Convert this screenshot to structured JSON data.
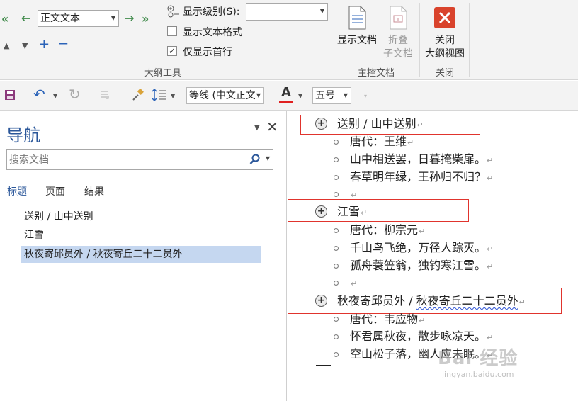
{
  "ribbon": {
    "outline_level": {
      "value": "正文文本"
    },
    "show_level": {
      "label": "显示级别(S):",
      "value": ""
    },
    "show_text_formatting": {
      "label": "显示文本格式",
      "checked": false
    },
    "show_first_line_only": {
      "label": "仅显示首行",
      "checked": true
    },
    "outline_tools_group": "大纲工具",
    "show_document": "显示文档",
    "collapse_subdocs": [
      "折叠",
      "子文档"
    ],
    "master_document_group": "主控文档",
    "close_outline_view": [
      "关闭",
      "大纲视图"
    ],
    "close_group": "关闭",
    "icons": {
      "promote_to_heading1": "double-left-arrow-icon",
      "promote": "left-arrow-icon",
      "demote": "right-arrow-icon",
      "demote_to_body": "double-right-arrow-icon",
      "move_up": "triangle-up-icon",
      "move_down": "triangle-down-icon",
      "expand": "plus-icon",
      "collapse": "minus-icon",
      "show_document": "document-icon",
      "collapse_subdocs": "document-icon",
      "close_outline_view": "close-icon"
    },
    "accent_green": "#3f8a4a",
    "accent_blue": "#2b63b8",
    "close_red": "#d9432c"
  },
  "qat": {
    "font_name": "等线 (中文正文",
    "font_size": "五号",
    "font_color_letter": "A",
    "font_color_underline": "#e02020",
    "icons": [
      "save-icon",
      "undo-icon",
      "redo-icon",
      "format-painter-icon",
      "paintbrush-icon",
      "line-spacing-icon",
      "font-color-icon"
    ]
  },
  "nav": {
    "title": "导航",
    "search_placeholder": "搜索文档",
    "tabs": [
      {
        "label": "标题",
        "active": true
      },
      {
        "label": "页面",
        "active": false
      },
      {
        "label": "结果",
        "active": false
      }
    ],
    "headings": [
      {
        "text": "送别 / 山中送别",
        "selected": false
      },
      {
        "text": "江雪",
        "selected": false
      },
      {
        "text": "秋夜寄邱员外 / 秋夜寄丘二十二员外",
        "selected": true
      }
    ]
  },
  "document": {
    "lines": [
      {
        "kind": "heading",
        "text": "送别 / 山中送别"
      },
      {
        "kind": "body",
        "text": "唐代：王维"
      },
      {
        "kind": "body",
        "text": "山中相送罢，日暮掩柴扉。"
      },
      {
        "kind": "body",
        "text": "春草明年绿，王孙归不归？"
      },
      {
        "kind": "body",
        "text": ""
      },
      {
        "kind": "heading",
        "text": "江雪"
      },
      {
        "kind": "body",
        "text": "唐代：柳宗元"
      },
      {
        "kind": "body",
        "text": "千山鸟飞绝，万径人踪灭。"
      },
      {
        "kind": "body",
        "text": "孤舟蓑笠翁，独钓寒江雪。"
      },
      {
        "kind": "body",
        "text": ""
      },
      {
        "kind": "heading",
        "text_a": "秋夜寄邱员外 / ",
        "text_b": "秋夜寄丘二十二员外"
      },
      {
        "kind": "body",
        "text": "唐代：韦应物"
      },
      {
        "kind": "body",
        "text": "怀君属秋夜，散步咏凉天。"
      },
      {
        "kind": "body",
        "text": "空山松子落，幽人应未眠。"
      }
    ],
    "paragraph_mark": "↵",
    "highlight_box_color": "#e0342d"
  },
  "watermark": {
    "text": "Bai 经验",
    "url": "jingyan.baidu.com"
  }
}
